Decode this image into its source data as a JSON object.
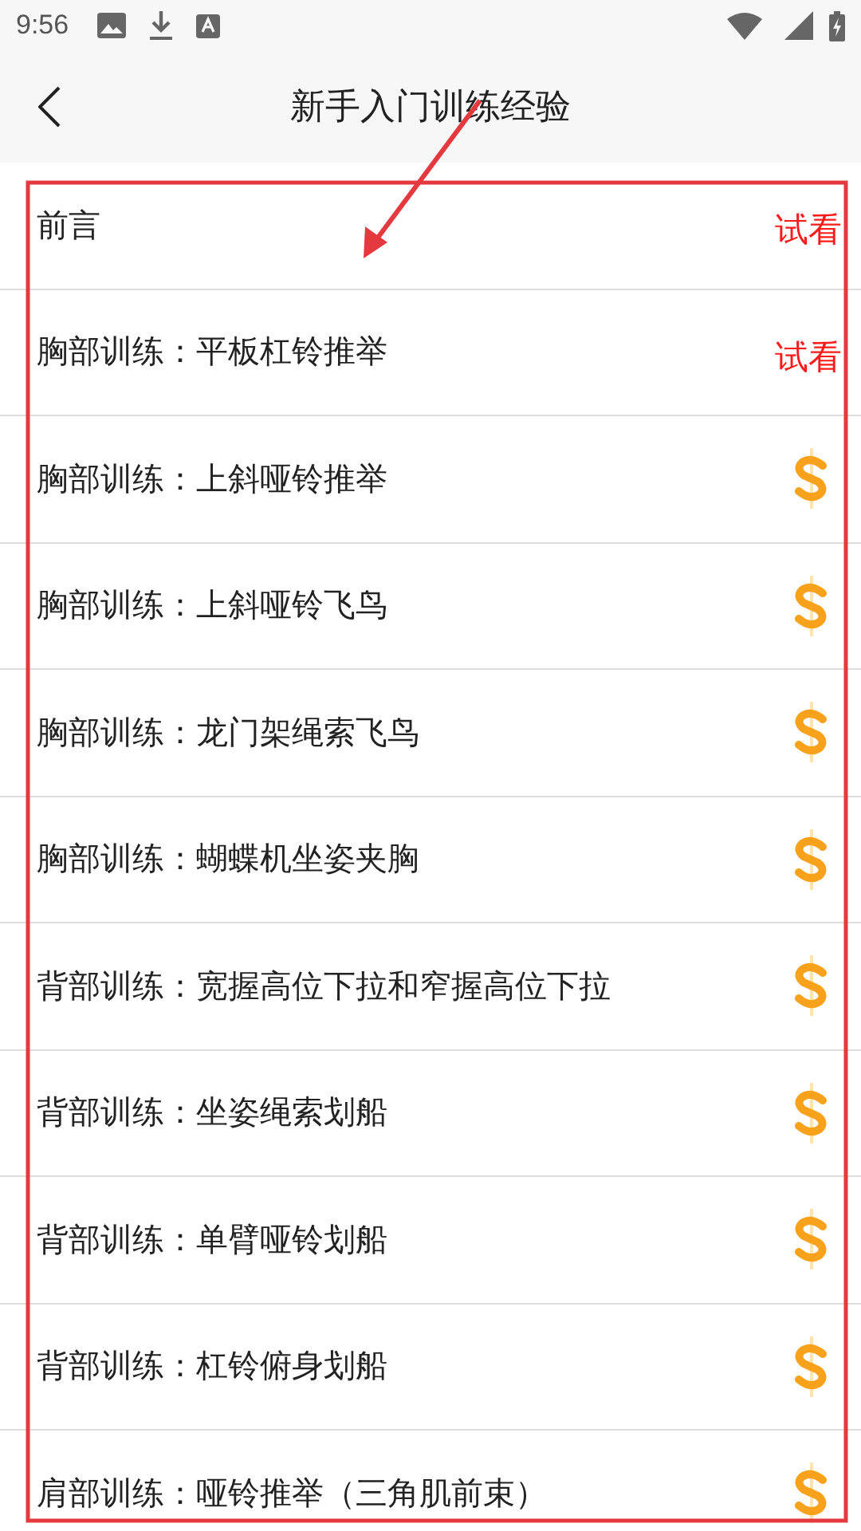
{
  "status_bar": {
    "time": "9:56"
  },
  "header": {
    "title": "新手入门训练经验"
  },
  "items": [
    {
      "title": "前言",
      "kind": "trial",
      "badge": "试看"
    },
    {
      "title": "胸部训练：平板杠铃推举",
      "kind": "trial",
      "badge": "试看"
    },
    {
      "title": "胸部训练：上斜哑铃推举",
      "kind": "paid"
    },
    {
      "title": "胸部训练：上斜哑铃飞鸟",
      "kind": "paid"
    },
    {
      "title": "胸部训练：龙门架绳索飞鸟",
      "kind": "paid"
    },
    {
      "title": "胸部训练：蝴蝶机坐姿夹胸",
      "kind": "paid"
    },
    {
      "title": "背部训练：宽握高位下拉和窄握高位下拉",
      "kind": "paid"
    },
    {
      "title": "背部训练：坐姿绳索划船",
      "kind": "paid"
    },
    {
      "title": "背部训练：单臂哑铃划船",
      "kind": "paid"
    },
    {
      "title": "背部训练：杠铃俯身划船",
      "kind": "paid"
    },
    {
      "title": "肩部训练：哑铃推举（三角肌前束）",
      "kind": "paid"
    }
  ],
  "annotations": {
    "highlight_box": true,
    "arrow": true
  }
}
